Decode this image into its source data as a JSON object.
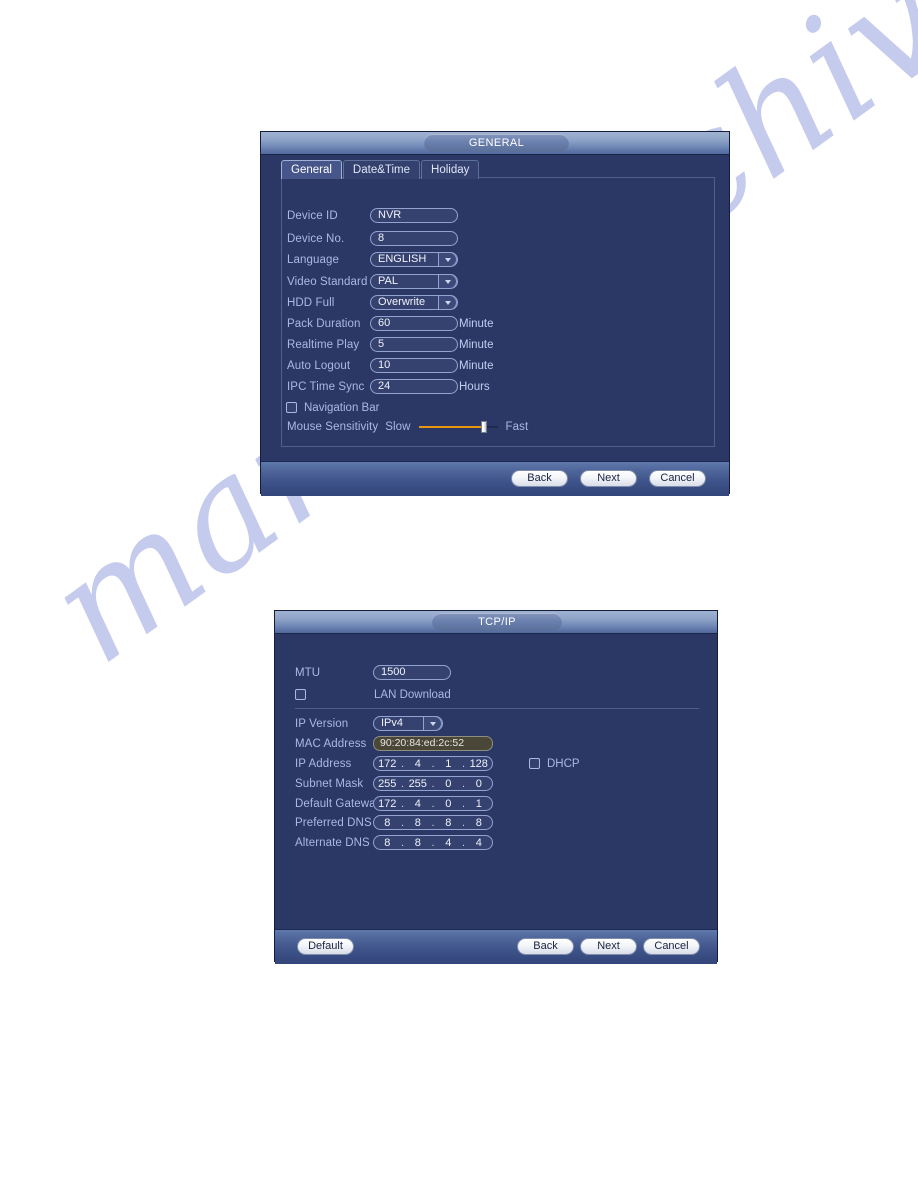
{
  "page": {
    "background": "#ffffff",
    "watermark": "manualarchive.com",
    "watermark_color": "#b9c0ea"
  },
  "theme": {
    "dialog_bg": "#2b3866",
    "label_color": "#a9b8e8",
    "accent_orange": "#e8960f",
    "field_bg": "#35426f",
    "disabled_field_bg": "#4a4739"
  },
  "general_dialog": {
    "title": "GENERAL",
    "tabs": [
      {
        "label": "General",
        "active": true
      },
      {
        "label": "Date&Time",
        "active": false
      },
      {
        "label": "Holiday",
        "active": false
      }
    ],
    "fields": [
      {
        "label": "Device ID",
        "value": "NVR",
        "type": "text",
        "unit": ""
      },
      {
        "label": "Device No.",
        "value": "8",
        "type": "text",
        "unit": ""
      },
      {
        "label": "Language",
        "value": "ENGLISH",
        "type": "select",
        "unit": ""
      },
      {
        "label": "Video Standard",
        "value": "PAL",
        "type": "select",
        "unit": ""
      },
      {
        "label": "HDD Full",
        "value": "Overwrite",
        "type": "select",
        "unit": ""
      },
      {
        "label": "Pack Duration",
        "value": "60",
        "type": "text",
        "unit": "Minute"
      },
      {
        "label": "Realtime Play",
        "value": "5",
        "type": "text",
        "unit": "Minute"
      },
      {
        "label": "Auto Logout",
        "value": "10",
        "type": "text",
        "unit": "Minute"
      },
      {
        "label": "IPC Time Sync",
        "value": "24",
        "type": "text",
        "unit": "Hours"
      }
    ],
    "navigation_bar": {
      "label": "Navigation Bar",
      "checked": false
    },
    "mouse_sensitivity": {
      "label": "Mouse Sensitivity",
      "min_label": "Slow",
      "max_label": "Fast",
      "position_percent": 85
    },
    "buttons": [
      {
        "label": "Back"
      },
      {
        "label": "Next"
      },
      {
        "label": "Cancel"
      }
    ]
  },
  "tcpip_dialog": {
    "title": "TCP/IP",
    "mtu": {
      "label": "MTU",
      "value": "1500"
    },
    "lan_download": {
      "label": "LAN Download",
      "checked": false
    },
    "ip_version": {
      "label": "IP Version",
      "value": "IPv4"
    },
    "mac_address": {
      "label": "MAC Address",
      "value": "90:20:84:ed:2c:52"
    },
    "ip_address": {
      "label": "IP Address",
      "octets": [
        "172",
        "4",
        "1",
        "128"
      ]
    },
    "subnet_mask": {
      "label": "Subnet Mask",
      "octets": [
        "255",
        "255",
        "0",
        "0"
      ]
    },
    "default_gateway": {
      "label": "Default Gateway",
      "octets": [
        "172",
        "4",
        "0",
        "1"
      ]
    },
    "preferred_dns": {
      "label": "Preferred DNS",
      "octets": [
        "8",
        "8",
        "8",
        "8"
      ]
    },
    "alternate_dns": {
      "label": "Alternate DNS",
      "octets": [
        "8",
        "8",
        "4",
        "4"
      ]
    },
    "dhcp": {
      "label": "DHCP",
      "checked": false
    },
    "buttons": {
      "default": {
        "label": "Default"
      },
      "back": {
        "label": "Back"
      },
      "next": {
        "label": "Next"
      },
      "cancel": {
        "label": "Cancel"
      }
    }
  }
}
